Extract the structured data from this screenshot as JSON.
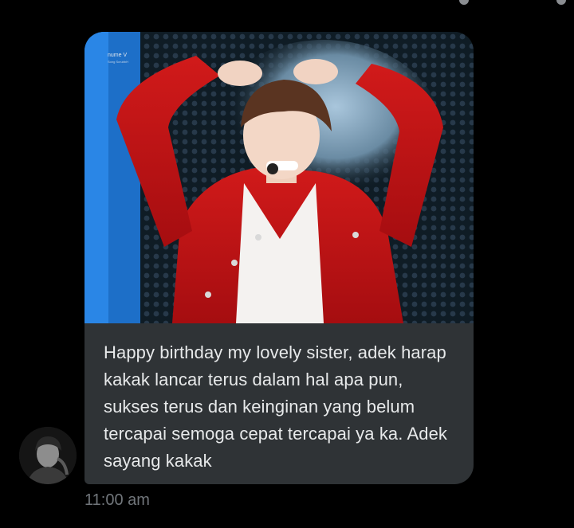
{
  "message": {
    "image": {
      "alt": "",
      "watermark": "nume V",
      "watermark_sub": "Song ScrubbH"
    },
    "text": "Happy birthday my lovely sister, adek harap kakak lancar terus dalam hal apa pun, sukses terus dan keinginan yang belum tercapai semoga cepat tercapai ya ka. Adek sayang kakak",
    "timestamp": "11:00 am"
  },
  "sender": {
    "avatar_icon": "profile-avatar"
  },
  "colors": {
    "background": "#000000",
    "bubble": "#2f3336",
    "text": "#e7e9ea",
    "timestamp": "#71767b"
  }
}
